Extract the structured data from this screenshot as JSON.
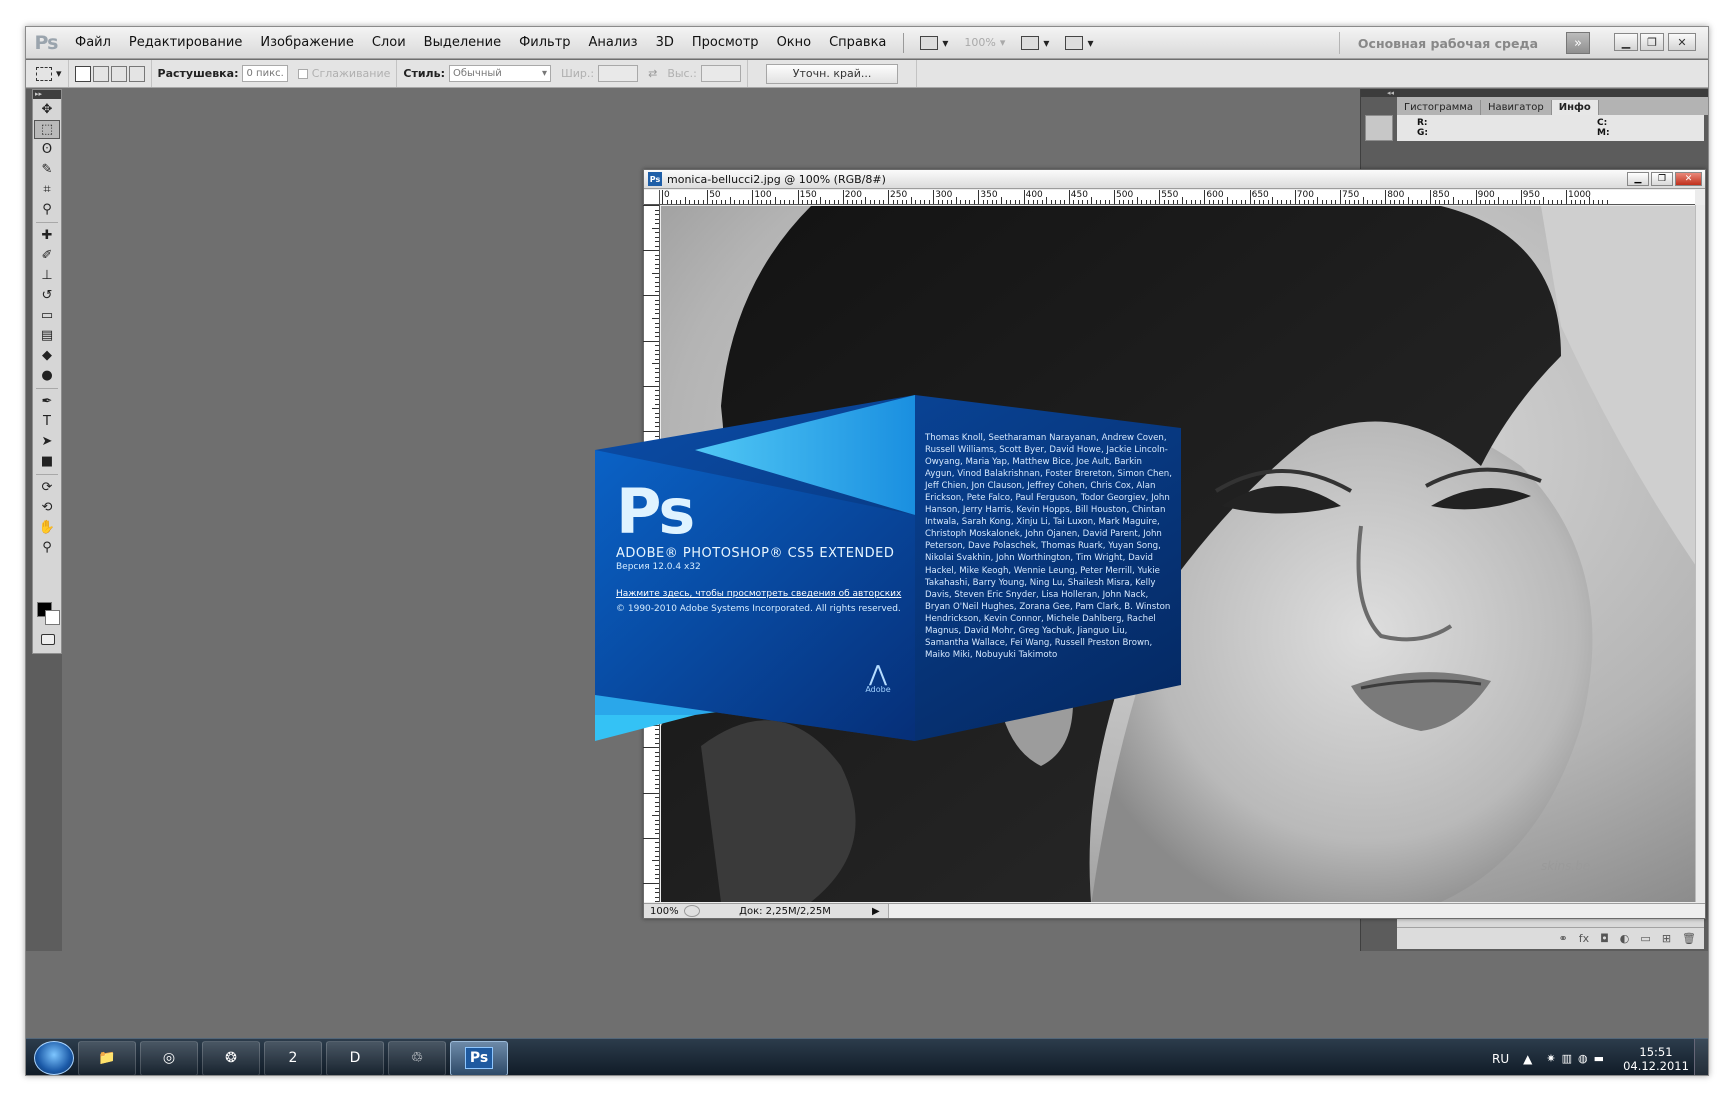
{
  "app": {
    "logo": "Ps",
    "menu": [
      "Файл",
      "Редактирование",
      "Изображение",
      "Слои",
      "Выделение",
      "Фильтр",
      "Анализ",
      "3D",
      "Просмотр",
      "Окно",
      "Справка"
    ],
    "zoom_dropdown": "100%",
    "workspace": "Основная рабочая среда"
  },
  "options": {
    "feather_label": "Растушевка:",
    "feather_value": "0 пикс.",
    "antialias_label": "Сглаживание",
    "style_label": "Стиль:",
    "style_value": "Обычный",
    "width_label": "Шир.:",
    "height_label": "Выс.:",
    "refine_edge_button": "Уточн. край..."
  },
  "panel": {
    "tabs": [
      "Гистограмма",
      "Навигатор",
      "Инфо"
    ],
    "active_tab": "Инфо",
    "info": {
      "r": "R:",
      "g": "G:",
      "c": "C:",
      "m": "M:"
    }
  },
  "document": {
    "title": "monica-bellucci2.jpg @ 100% (RGB/8#)",
    "zoom": "100%",
    "doc_size": "Док: 2,25M/2,25M",
    "ruler_labels": [
      "0",
      "50",
      "100",
      "150",
      "200",
      "250",
      "300",
      "350",
      "400",
      "450",
      "500",
      "550",
      "600",
      "650",
      "700",
      "750",
      "800",
      "850",
      "900",
      "950",
      "1000"
    ]
  },
  "splash": {
    "logo": "Ps",
    "product": "ADOBE® PHOTOSHOP® CS5 EXTENDED",
    "version": "Версия 12.0.4 x32",
    "legal_link": "Нажмите здесь, чтобы просмотреть сведения об авторских",
    "copyright": "© 1990-2010 Adobe Systems Incorporated. All rights reserved.",
    "credits": "Thomas Knoll, Seetharaman Narayanan, Andrew Coven, Russell Williams, Scott Byer, David Howe, Jackie Lincoln-Owyang, Maria Yap, Matthew Bice, Joe Ault, Barkin Aygun, Vinod Balakrishnan, Foster Brereton, Simon Chen, Jeff Chien, Jon Clauson, Jeffrey Cohen, Chris Cox, Alan Erickson, Pete Falco, Paul Ferguson, Todor Georgiev, John Hanson, Jerry Harris, Kevin Hopps, Bill Houston, Chintan Intwala, Sarah Kong, Xinju Li, Tai Luxon, Mark Maguire, Christoph Moskalonek, John Ojanen, David Parent, John Peterson, Dave Polaschek, Thomas Ruark, Yuyan Song, Nikolai Svakhin, John Worthington, Tim Wright, David Hackel, Mike Keogh, Wennie Leung, Peter Merrill, Yukie Takahashi, Barry Young, Ning Lu, Shailesh Misra, Kelly Davis, Steven Eric Snyder, Lisa Holleran, John Nack, Bryan O'Neil Hughes, Zorana Gee, Pam Clark, B. Winston Hendrickson, Kevin Connor, Michele Dahlberg, Rachel Magnus, David Mohr, Greg Yachuk, Jianguo Liu, Samantha Wallace, Fei Wang, Russell Preston Brown, Maiko Miki, Nobuyuki Takimoto",
    "adobe_label": "Adobe"
  },
  "taskbar": {
    "ps_label": "Ps",
    "task2_label": "2",
    "language": "RU",
    "time": "15:51",
    "date": "04.12.2011"
  },
  "colors": {
    "splash_dark": "#073b8a",
    "splash_mid": "#0d63c8",
    "splash_light": "#35b6f0",
    "canvas_bg": "#6f6f6f"
  }
}
